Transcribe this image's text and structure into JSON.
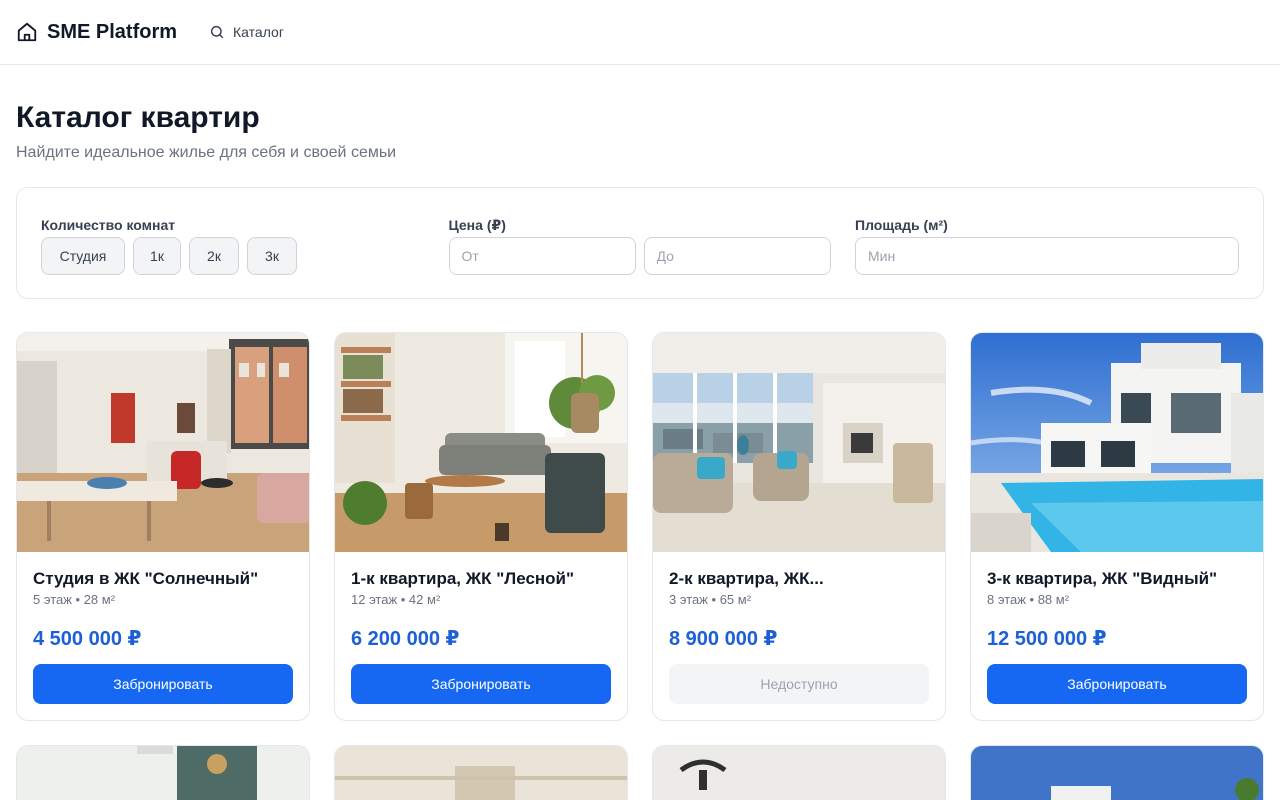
{
  "header": {
    "brand": "SME Platform",
    "nav_catalog": "Каталог"
  },
  "page": {
    "title": "Каталог квартир",
    "subtitle": "Найдите идеальное жилье для себя и своей семьи"
  },
  "filters": {
    "rooms_label": "Количество комнат",
    "rooms": [
      "Студия",
      "1к",
      "2к",
      "3к"
    ],
    "price_label": "Цена (₽)",
    "price_from_placeholder": "От",
    "price_to_placeholder": "До",
    "area_label": "Площадь (м²)",
    "area_min_placeholder": "Мин"
  },
  "listings": [
    {
      "title": "Студия в ЖК \"Солнечный\"",
      "meta": "5 этаж • 28 м²",
      "price": "4 500 000 ₽",
      "button": "Забронировать",
      "available": true,
      "image": "studio-interior"
    },
    {
      "title": "1-к квартира, ЖК \"Лесной\"",
      "meta": "12 этаж • 42 м²",
      "price": "6 200 000 ₽",
      "button": "Забронировать",
      "available": true,
      "image": "living-room-plants"
    },
    {
      "title": "2-к квартира, ЖК...",
      "meta": "3 этаж • 65 м²",
      "price": "8 900 000 ₽",
      "button": "Недоступно",
      "available": false,
      "image": "bright-living-room"
    },
    {
      "title": "3-к квартира, ЖК \"Видный\"",
      "meta": "8 этаж • 88 м²",
      "price": "12 500 000 ₽",
      "button": "Забронировать",
      "available": true,
      "image": "villa-pool"
    }
  ],
  "colors": {
    "accent": "#1668f2",
    "price": "#1d5fd6",
    "border": "#e5e7eb",
    "muted": "#6b7280"
  }
}
